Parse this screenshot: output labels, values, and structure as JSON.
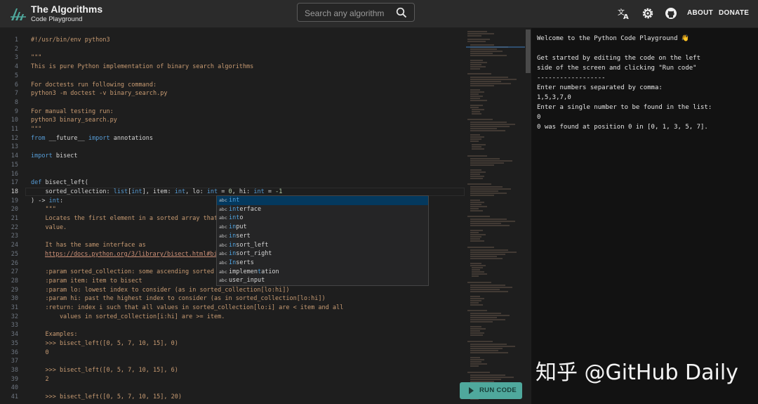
{
  "header": {
    "title": "The Algorithms",
    "subtitle": "Code Playground",
    "search_placeholder": "Search any algorithm",
    "about": "ABOUT",
    "donate": "DONATE"
  },
  "editor": {
    "line_numbers": [
      "1",
      "2",
      "3",
      "4",
      "5",
      "6",
      "7",
      "8",
      "9",
      "10",
      "11",
      "12",
      "13",
      "14",
      "15",
      "16",
      "17",
      "18",
      "19",
      "20",
      "21",
      "22",
      "23",
      "24",
      "25",
      "26",
      "27",
      "28",
      "29",
      "30",
      "31",
      "32",
      "33",
      "34",
      "35",
      "36",
      "37",
      "38",
      "39",
      "40",
      "41"
    ],
    "lines": {
      "l1": "#!/usr/bin/env python3",
      "l3": "\"\"\"",
      "l4": "This is pure Python implementation of binary search algorithms",
      "l6": "For doctests run following command:",
      "l7": "python3 -m doctest -v binary_search.py",
      "l9": "For manual testing run:",
      "l10": "python3 binary_search.py",
      "l11": "\"\"\"",
      "l12_from": "from",
      "l12_mod": " __future__ ",
      "l12_import": "import",
      "l12_name": " annotations",
      "l14_import": "import",
      "l14_name": " bisect",
      "l17_def": "def",
      "l17_name": " bisect_left(",
      "l18_a": "    sorted_collection: ",
      "l18_b": "list",
      "l18_c": "[",
      "l18_d": "int",
      "l18_e": "], item: ",
      "l18_f": "int",
      "l18_g": ", lo: ",
      "l18_h": "int",
      "l18_i": " = ",
      "l18_j": "0",
      "l18_k": ", hi: ",
      "l18_l": "int",
      "l18_m": " = ",
      "l18_n": "-1",
      "l19_a": ") -> ",
      "l19_b": "int",
      "l19_c": ":",
      "l20": "    \"\"\"",
      "l21": "    Locates the first element in a sorted array that",
      "l22": "    value.",
      "l24": "    It has the same interface as",
      "l25": "https://docs.python.org/3/library/bisect.html#bi",
      "l27": "    :param sorted_collection: some ascending sorted",
      "l28": "    :param item: item to bisect",
      "l29": "    :param lo: lowest index to consider (as in sorted_collection[lo:hi])",
      "l30": "    :param hi: past the highest index to consider (as in sorted_collection[lo:hi])",
      "l31": "    :return: index i such that all values in sorted_collection[lo:i] are < item and all",
      "l32": "        values in sorted_collection[i:hi] are >= item.",
      "l34": "    Examples:",
      "l35": "    >>> bisect_left([0, 5, 7, 10, 15], 0)",
      "l36": "    0",
      "l38": "    >>> bisect_left([0, 5, 7, 10, 15], 6)",
      "l39": "    2",
      "l41": "    >>> bisect_left([0, 5, 7, 10, 15], 20)"
    },
    "run_label": "RUN CODE"
  },
  "autocomplete": {
    "tag": "abc",
    "items": [
      {
        "match": "int",
        "rest": ""
      },
      {
        "match": "int",
        "rest": "erface"
      },
      {
        "match": "int",
        "rest": "o"
      },
      {
        "match": "in",
        "rest": "put"
      },
      {
        "match": "in",
        "rest": "sert"
      },
      {
        "match": "in",
        "rest": "sort_left"
      },
      {
        "match": "in",
        "rest": "sort_right"
      },
      {
        "match": "In",
        "rest": "serts"
      },
      {
        "pre": "implemen",
        "match": "t",
        "rest": "ation"
      },
      {
        "pre": "user_in",
        "match": "",
        "rest": "put"
      }
    ]
  },
  "output": {
    "lines": [
      "Welcome to the Python Code Playground 👋",
      "",
      "Get started by editing the code on the left",
      "side of the screen and clicking \"Run code\"",
      "------------------",
      "Enter numbers separated by comma:",
      "1,5,3,7,0",
      "Enter a single number to be found in the list:",
      "0",
      "0 was found at position 0 in [0, 1, 3, 5, 7]."
    ]
  },
  "watermark": "知乎 @GitHub Daily",
  "colors": {
    "accent": "#4fa89c",
    "comment": "#c89b72",
    "keyword": "#569cd6",
    "selection": "#04395e"
  }
}
